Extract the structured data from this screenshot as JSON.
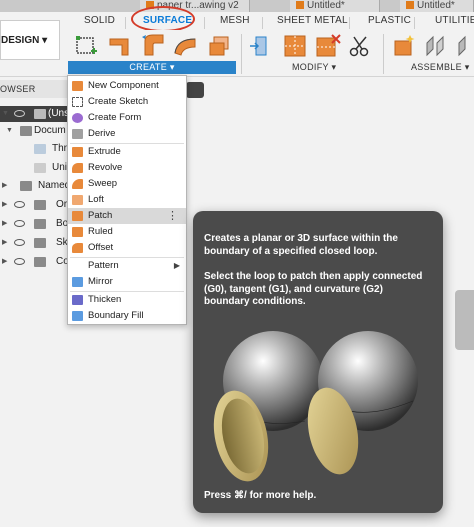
{
  "doc_tabs": [
    {
      "label": "paper tr...awing v2"
    },
    {
      "label": "Untitled*"
    },
    {
      "label": "Untitled*"
    }
  ],
  "workspace_tabs": [
    "SOLID",
    "SURFACE",
    "MESH",
    "SHEET METAL",
    "PLASTIC",
    "UTILITIES"
  ],
  "active_workspace": "SURFACE",
  "design_button": {
    "label": "DESIGN"
  },
  "toolbar_groups": {
    "create": "CREATE",
    "modify": "MODIFY",
    "assemble": "ASSEMBLE"
  },
  "browser": {
    "header": "OWSER",
    "rows": [
      {
        "label": "(Uns"
      },
      {
        "label": "Docum"
      },
      {
        "label": "Thre"
      },
      {
        "label": "Unit"
      },
      {
        "label": "Named"
      },
      {
        "label": "Or"
      },
      {
        "label": "Bo"
      },
      {
        "label": "Sk"
      },
      {
        "label": "Co"
      }
    ]
  },
  "menu": {
    "items": [
      {
        "label": "New Component",
        "icon": "new-component-icon"
      },
      {
        "label": "Create Sketch",
        "icon": "create-sketch-icon"
      },
      {
        "label": "Create Form",
        "icon": "create-form-icon"
      },
      {
        "label": "Derive",
        "icon": "derive-icon"
      },
      {
        "label": "Extrude",
        "icon": "extrude-icon"
      },
      {
        "label": "Revolve",
        "icon": "revolve-icon"
      },
      {
        "label": "Sweep",
        "icon": "sweep-icon"
      },
      {
        "label": "Loft",
        "icon": "loft-icon"
      },
      {
        "label": "Patch",
        "icon": "patch-icon"
      },
      {
        "label": "Ruled",
        "icon": "ruled-icon"
      },
      {
        "label": "Offset",
        "icon": "offset-icon"
      },
      {
        "label": "Pattern",
        "icon": "pattern-icon"
      },
      {
        "label": "Mirror",
        "icon": "mirror-icon"
      },
      {
        "label": "Thicken",
        "icon": "thicken-icon"
      },
      {
        "label": "Boundary Fill",
        "icon": "boundary-fill-icon"
      }
    ],
    "highlighted": "Patch"
  },
  "tooltip": {
    "p1": "Creates a planar or 3D surface within the boundary of a specified closed loop.",
    "p2": "Select the loop to patch then apply connected (G0), tangent (G1), and curvature (G2) boundary conditions.",
    "footer": "Press ⌘/ for more help."
  },
  "colors": {
    "accent": "#2a83c9",
    "active_tab": "#0a7bd8",
    "highlight_circle": "#d43c2a",
    "tooltip_bg": "#4b4b4b",
    "surface_orange": "#e8893a"
  }
}
